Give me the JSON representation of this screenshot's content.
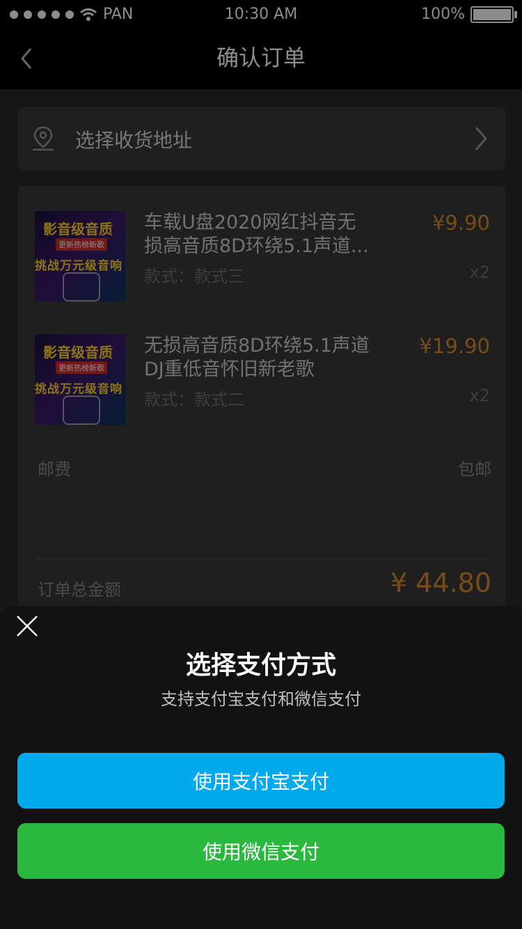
{
  "status_bar": {
    "carrier": "PAN",
    "time": "10:30 AM",
    "battery": "100%"
  },
  "nav": {
    "title": "确认订单"
  },
  "address": {
    "label": "选择收货地址"
  },
  "items": [
    {
      "title": "车载U盘2020网红抖音无损高音质8D环绕5.1声道...",
      "spec": "款式：款式三",
      "price": "¥9.90",
      "qty": "x2",
      "thumb_line1": "影音级音质",
      "thumb_line2": "更新热榜新歌",
      "thumb_line3": "挑战万元级音响"
    },
    {
      "title": "无损高音质8D环绕5.1声道DJ重低音怀旧新老歌",
      "spec": "款式：款式二",
      "price": "¥19.90",
      "qty": "x2",
      "thumb_line1": "影音级音质",
      "thumb_line2": "更新热榜新歌",
      "thumb_line3": "挑战万元级音响"
    }
  ],
  "shipping": {
    "label": "邮费",
    "value": "包邮"
  },
  "total": {
    "label": "订单总金额",
    "value": "¥ 44.80"
  },
  "payment_sheet": {
    "title": "选择支付方式",
    "subtitle": "支持支付宝支付和微信支付",
    "alipay_label": "使用支付宝支付",
    "wechat_label": "使用微信支付"
  },
  "colors": {
    "price": "#d88a2e",
    "alipay": "#02a9ec",
    "wechat": "#2ab83e"
  }
}
